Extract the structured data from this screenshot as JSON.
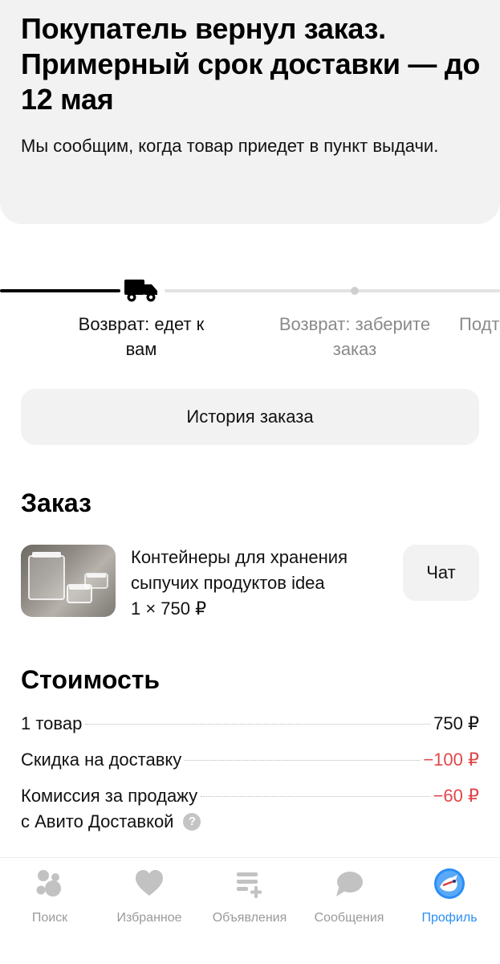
{
  "header": {
    "title": "Покупатель вернул заказ. Примерный срок доставки — до 12 мая",
    "subtitle": "Мы сообщим, когда товар приедет в пункт выдачи."
  },
  "progress": {
    "steps": [
      {
        "label": "Возврат: едет к вам",
        "state": "current"
      },
      {
        "label": "Возврат: заберите заказ",
        "state": "upcoming"
      },
      {
        "label": "Подт",
        "state": "upcoming"
      }
    ]
  },
  "history_button": {
    "label": "История заказа"
  },
  "order": {
    "title": "Заказ",
    "product": {
      "name": "Контейнеры для хранения сыпучих продуктов idea",
      "price": "1 × 750 ₽"
    },
    "chat_label": "Чат"
  },
  "cost": {
    "title": "Стоимость",
    "rows": [
      {
        "label": "1 товар",
        "value": "750 ₽"
      },
      {
        "label": "Скидка на доставку",
        "value": "−100 ₽"
      },
      {
        "label": "Комиссия за продажу",
        "label_line2": "с Авито Доставкой",
        "value": "−60 ₽"
      }
    ],
    "help_icon": "?"
  },
  "tabs": [
    {
      "label": "Поиск",
      "icon": "search-bubbles-icon"
    },
    {
      "label": "Избранное",
      "icon": "heart-icon"
    },
    {
      "label": "Объявления",
      "icon": "ads-list-icon"
    },
    {
      "label": "Сообщения",
      "icon": "chat-bubble-icon"
    },
    {
      "label": "Профиль",
      "icon": "avatar-icon",
      "active": true
    }
  ],
  "colors": {
    "accent": "#2a8ef5",
    "negative": "#e0474c",
    "card_bg": "#f2f2f2"
  }
}
